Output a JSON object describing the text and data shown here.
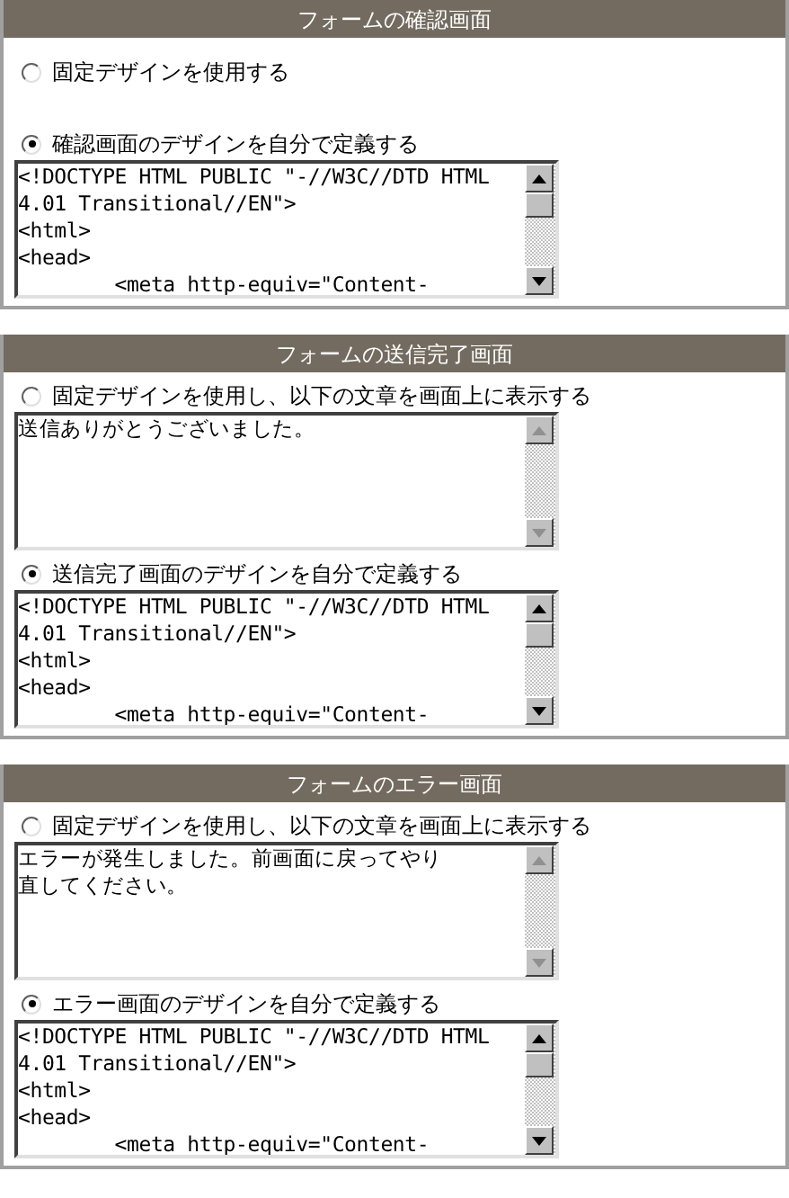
{
  "panels": [
    {
      "title": "フォームの確認画面",
      "options": [
        {
          "label": "固定デザインを使用する",
          "selected": false
        },
        {
          "label": "確認画面のデザインを自分で定義する",
          "selected": true,
          "textarea": {
            "scrollable": true,
            "lines": [
              "<!DOCTYPE HTML PUBLIC \"-//W3C//DTD HTML",
              "4.01 Transitional//EN\">",
              "<html>",
              "<head>",
              "        <meta http-equiv=\"Content-"
            ]
          }
        }
      ]
    },
    {
      "title": "フォームの送信完了画面",
      "options": [
        {
          "label": "固定デザインを使用し、以下の文章を画面上に表示する",
          "selected": false,
          "textarea": {
            "scrollable": false,
            "lines": [
              "送信ありがとうございました。"
            ]
          }
        },
        {
          "label": "送信完了画面のデザインを自分で定義する",
          "selected": true,
          "textarea": {
            "scrollable": true,
            "lines": [
              "<!DOCTYPE HTML PUBLIC \"-//W3C//DTD HTML",
              "4.01 Transitional//EN\">",
              "<html>",
              "<head>",
              "        <meta http-equiv=\"Content-"
            ]
          }
        }
      ]
    },
    {
      "title": "フォームのエラー画面",
      "options": [
        {
          "label": "固定デザインを使用し、以下の文章を画面上に表示する",
          "selected": false,
          "textarea": {
            "scrollable": false,
            "lines": [
              "エラーが発生しました。前画面に戻ってやり",
              "直してください。"
            ]
          }
        },
        {
          "label": "エラー画面のデザインを自分で定義する",
          "selected": true,
          "textarea": {
            "scrollable": true,
            "lines": [
              "<!DOCTYPE HTML PUBLIC \"-//W3C//DTD HTML",
              "4.01 Transitional//EN\">",
              "<html>",
              "<head>",
              "        <meta http-equiv=\"Content-"
            ]
          }
        }
      ]
    }
  ]
}
